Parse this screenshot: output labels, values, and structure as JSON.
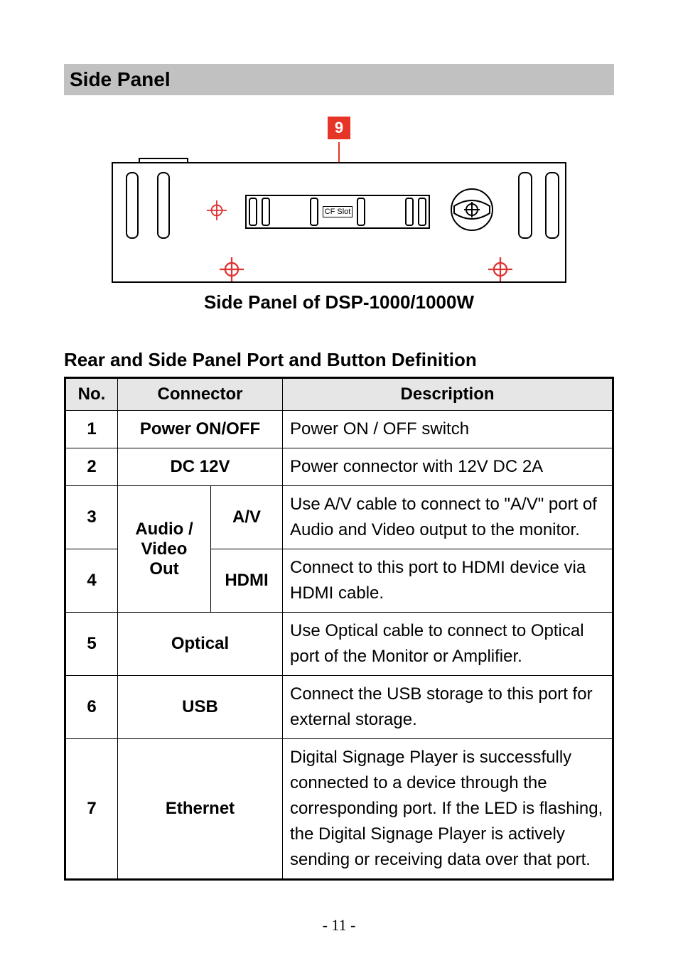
{
  "headingBar": "Side Panel",
  "callout": "9",
  "cfLabel": "CF Slot",
  "caption": "Side Panel of DSP-1000/1000W",
  "tableTitle": "Rear and Side Panel Port and Button Definition",
  "headers": {
    "no": "No.",
    "connector": "Connector",
    "description": "Description"
  },
  "rows": {
    "r1": {
      "no": "1",
      "conn": "Power ON/OFF",
      "desc": "Power ON / OFF switch"
    },
    "r2": {
      "no": "2",
      "conn": "DC 12V",
      "desc": "Power connector with 12V DC 2A"
    },
    "r34groupLabel": "Audio / Video Out",
    "r3": {
      "no": "3",
      "sub": "A/V",
      "desc": "Use A/V cable to connect to \"A/V\" port of Audio and Video output to the monitor."
    },
    "r4": {
      "no": "4",
      "sub": "HDMI",
      "desc": "Connect to this port to HDMI device via HDMI cable."
    },
    "r5": {
      "no": "5",
      "conn": "Optical",
      "desc": "Use Optical cable to connect to Optical port of the Monitor or Amplifier."
    },
    "r6": {
      "no": "6",
      "conn": "USB",
      "desc": "Connect the USB storage to this port for external storage."
    },
    "r7": {
      "no": "7",
      "conn": "Ethernet",
      "desc": "Digital Signage Player is successfully connected to a device through the corresponding port. If the LED is flashing, the Digital Signage Player is actively sending or receiving data over that port."
    }
  },
  "pageNumber": "- 11 -"
}
